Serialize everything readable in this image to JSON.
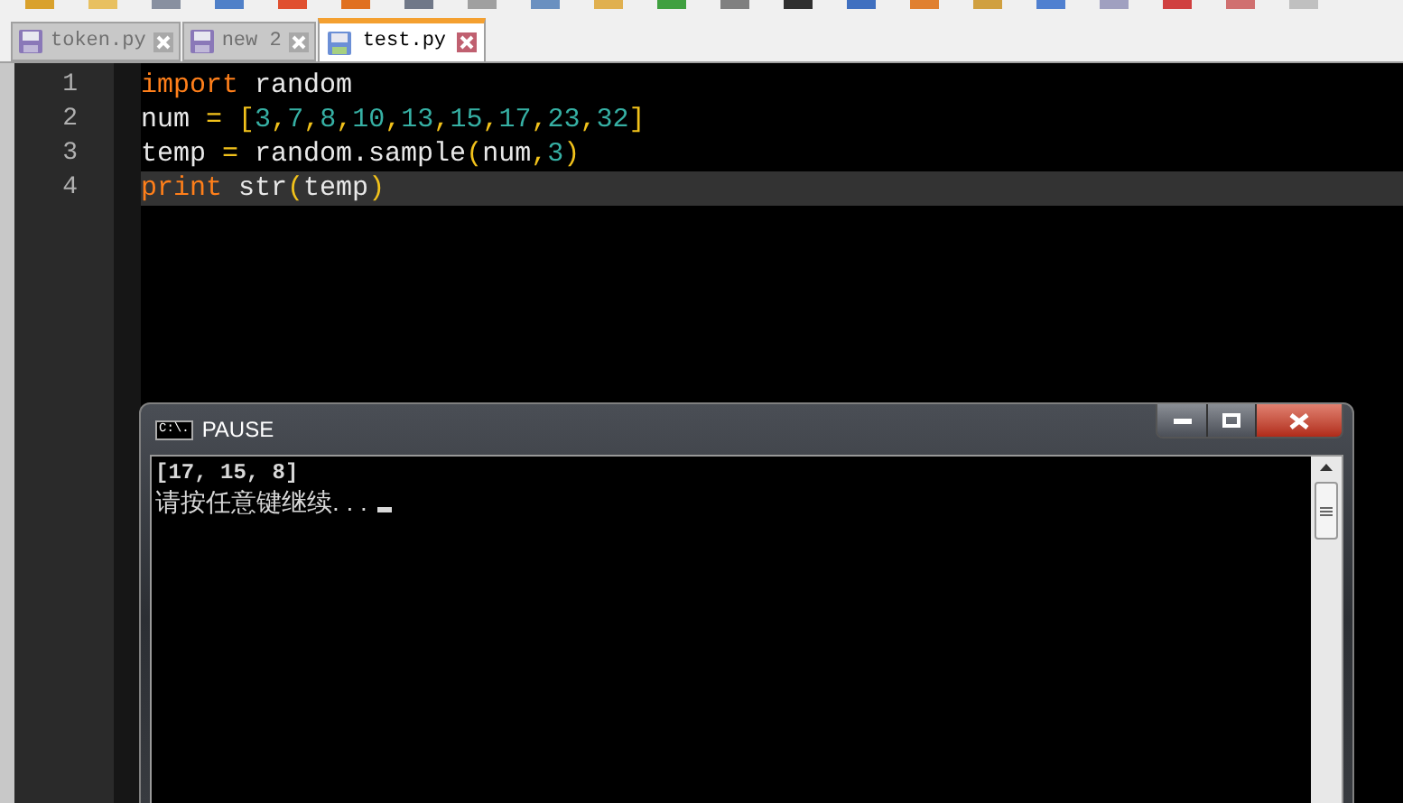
{
  "tabs": [
    {
      "label": "token.py",
      "selected": false
    },
    {
      "label": "new 2",
      "selected": false
    },
    {
      "label": "test.py",
      "selected": true
    }
  ],
  "editor": {
    "lines": [
      {
        "number": "1",
        "current": false,
        "tokens": [
          {
            "text": "import",
            "kind": "keyword"
          },
          {
            "text": " random",
            "kind": "plain"
          }
        ]
      },
      {
        "number": "2",
        "current": false,
        "tokens": [
          {
            "text": "num ",
            "kind": "plain"
          },
          {
            "text": "= [",
            "kind": "operator"
          },
          {
            "text": "3",
            "kind": "number"
          },
          {
            "text": ",",
            "kind": "operator"
          },
          {
            "text": "7",
            "kind": "number"
          },
          {
            "text": ",",
            "kind": "operator"
          },
          {
            "text": "8",
            "kind": "number"
          },
          {
            "text": ",",
            "kind": "operator"
          },
          {
            "text": "10",
            "kind": "number"
          },
          {
            "text": ",",
            "kind": "operator"
          },
          {
            "text": "13",
            "kind": "number"
          },
          {
            "text": ",",
            "kind": "operator"
          },
          {
            "text": "15",
            "kind": "number"
          },
          {
            "text": ",",
            "kind": "operator"
          },
          {
            "text": "17",
            "kind": "number"
          },
          {
            "text": ",",
            "kind": "operator"
          },
          {
            "text": "23",
            "kind": "number"
          },
          {
            "text": ",",
            "kind": "operator"
          },
          {
            "text": "32",
            "kind": "number"
          },
          {
            "text": "]",
            "kind": "operator"
          }
        ]
      },
      {
        "number": "3",
        "current": false,
        "tokens": [
          {
            "text": "temp ",
            "kind": "plain"
          },
          {
            "text": "=",
            "kind": "operator"
          },
          {
            "text": " random.sample",
            "kind": "plain"
          },
          {
            "text": "(",
            "kind": "operator"
          },
          {
            "text": "num",
            "kind": "plain"
          },
          {
            "text": ",",
            "kind": "operator"
          },
          {
            "text": "3",
            "kind": "number"
          },
          {
            "text": ")",
            "kind": "operator"
          }
        ]
      },
      {
        "number": "4",
        "current": true,
        "tokens": [
          {
            "text": "print",
            "kind": "keyword"
          },
          {
            "text": " str",
            "kind": "plain"
          },
          {
            "text": "(",
            "kind": "operator"
          },
          {
            "text": "temp",
            "kind": "plain"
          },
          {
            "text": ")",
            "kind": "operator"
          }
        ]
      }
    ]
  },
  "console": {
    "title": "PAUSE",
    "icon_text": "C:\\.",
    "output": [
      "[17, 15, 8]",
      "请按任意键继续. . ."
    ]
  }
}
